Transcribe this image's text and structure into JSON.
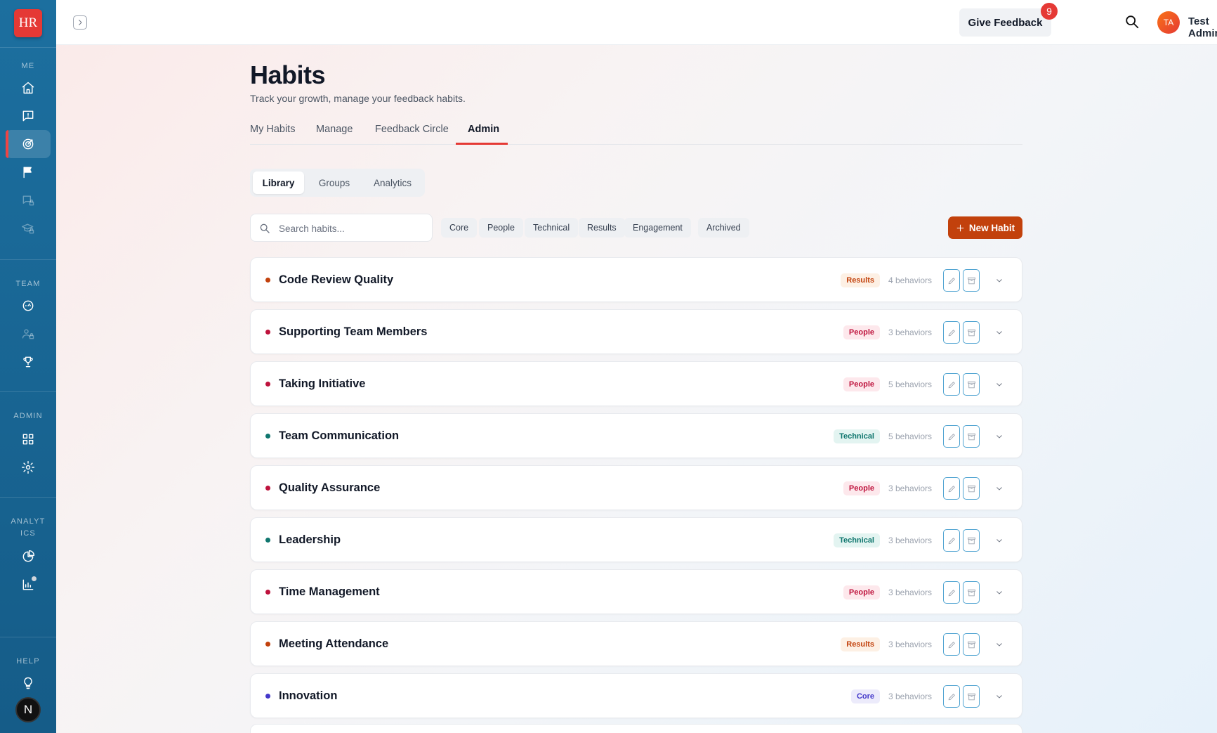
{
  "app": {
    "logo_text": "HR"
  },
  "sidebar": {
    "sections": {
      "me": "ME",
      "team": "TEAM",
      "admin": "ADMIN",
      "analytics": "ANALYT ICS",
      "help": "HELP"
    },
    "help_avatar": "N"
  },
  "topbar": {
    "give_feedback": "Give Feedback",
    "notification_count": "9",
    "user_initials": "TA",
    "user_name": "Test Admin"
  },
  "page": {
    "title": "Habits",
    "subtitle": "Track your growth, manage your feedback habits."
  },
  "tabs": [
    {
      "label": "My Habits",
      "active": false
    },
    {
      "label": "Manage",
      "active": false
    },
    {
      "label": "Feedback Circle",
      "active": false
    },
    {
      "label": "Admin",
      "active": true
    }
  ],
  "subtabs": [
    {
      "label": "Library",
      "active": true
    },
    {
      "label": "Groups",
      "active": false
    },
    {
      "label": "Analytics",
      "active": false
    }
  ],
  "search": {
    "placeholder": "Search habits..."
  },
  "filters": [
    "Core",
    "People",
    "Technical",
    "Results",
    "Engagement",
    "Archived"
  ],
  "new_habit_label": "New Habit",
  "colors": {
    "results": "#c2410c",
    "people": "#be123c",
    "technical": "#0f766e",
    "core": "#4338ca",
    "accent": "#e53935"
  },
  "habits": [
    {
      "name": "Code Review Quality",
      "category": "Results",
      "behaviors": "4 behaviors"
    },
    {
      "name": "Supporting Team Members",
      "category": "People",
      "behaviors": "3 behaviors"
    },
    {
      "name": "Taking Initiative",
      "category": "People",
      "behaviors": "5 behaviors"
    },
    {
      "name": "Team Communication",
      "category": "Technical",
      "behaviors": "5 behaviors"
    },
    {
      "name": "Quality Assurance",
      "category": "People",
      "behaviors": "3 behaviors"
    },
    {
      "name": "Leadership",
      "category": "Technical",
      "behaviors": "3 behaviors"
    },
    {
      "name": "Time Management",
      "category": "People",
      "behaviors": "3 behaviors"
    },
    {
      "name": "Meeting Attendance",
      "category": "Results",
      "behaviors": "3 behaviors"
    },
    {
      "name": "Innovation",
      "category": "Core",
      "behaviors": "3 behaviors"
    }
  ]
}
